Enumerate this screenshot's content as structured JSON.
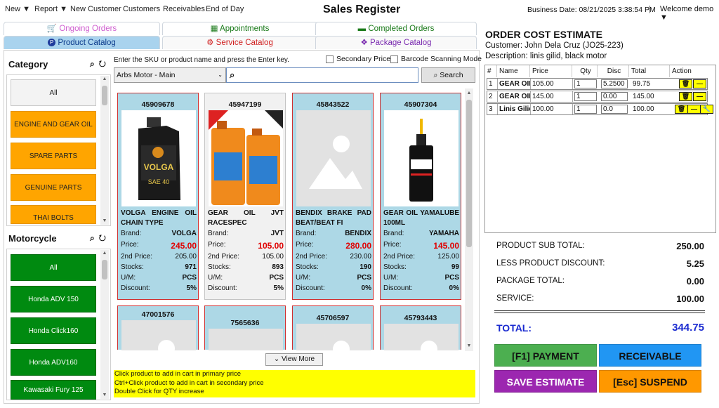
{
  "topbar": {
    "menu": [
      {
        "label": "New",
        "caret": "▼"
      },
      {
        "label": "Report",
        "caret": "▼"
      },
      {
        "label": "New Customer"
      },
      {
        "label": "Customers"
      },
      {
        "label": "Receivables"
      },
      {
        "label": "End of Day"
      }
    ],
    "title": "Sales Register",
    "business_date": "Business Date: 08/21/2025 3:38:54 PM",
    "separator": "|",
    "welcome": "Welcome demo ▼"
  },
  "tabs": {
    "row1": [
      "Ongoing Orders",
      "Appointments",
      "Completed Orders"
    ],
    "row2": [
      "Product Catalog",
      "Service Catalog",
      "Package Catalog"
    ],
    "icons": {
      "ongoing": "cart-icon",
      "appointments": "calendar-icon",
      "completed": "box-icon",
      "product": "product-icon",
      "service": "gears-icon",
      "package": "gift-icon"
    }
  },
  "sidebar": {
    "category_title": "Category",
    "categories": [
      "All",
      "ENGINE AND GEAR OIL",
      "SPARE PARTS",
      "GENUINE PARTS",
      "THAI BOLTS"
    ],
    "motorcycle_title": "Motorcycle",
    "motorcycles": [
      "All",
      "Honda ADV 150",
      "Honda Click160",
      "Honda ADV160",
      "Kawasaki Fury 125"
    ],
    "colors": {
      "orange": "#ffa500",
      "green": "#008a10"
    }
  },
  "catalog": {
    "hint": "Enter the SKU or product name and press the Enter key.",
    "secondary_price_label": "Secondary Price",
    "barcode_label": "Barcode Scanning Mode",
    "branch_select": "Arbs Motor - Main",
    "search_value": "",
    "search_button": "Search",
    "row_labels": {
      "brand": "Brand:",
      "price": "Price:",
      "price2": "2nd Price:",
      "stocks": "Stocks:",
      "um": "U/M:",
      "discount": "Discount:"
    },
    "products": [
      {
        "sku": "45909678",
        "name": "VOLGA ENGINE OIL CHAIN TYPE",
        "brand": "VOLGA",
        "price": "245.00",
        "price2": "205.00",
        "stocks": "971",
        "um": "PCS",
        "discount": "5%"
      },
      {
        "sku": "45947199",
        "name": "GEAR OIL JVT RACESPEC",
        "brand": "JVT",
        "price": "105.00",
        "price2": "105.00",
        "stocks": "893",
        "um": "PCS",
        "discount": "5%"
      },
      {
        "sku": "45843522",
        "name": "BENDIX BRAKE PAD BEAT/BEAT FI",
        "brand": "BENDIX",
        "price": "280.00",
        "price2": "230.00",
        "stocks": "190",
        "um": "PCS",
        "discount": "0%"
      },
      {
        "sku": "45907304",
        "name": "GEAR OIL YAMALUBE 100ML",
        "brand": "YAMAHA",
        "price": "145.00",
        "price2": "125.00",
        "stocks": "99",
        "um": "PCS",
        "discount": "0%"
      }
    ],
    "products_row2": [
      "47001576",
      "7565636",
      "45706597",
      "45793443"
    ],
    "view_more": "View More",
    "instructions": [
      "Click product to add in cart in primary price",
      "Ctrl+Click product to add in cart in secondary price",
      "Double Click for QTY increase"
    ]
  },
  "order": {
    "title": "ORDER COST ESTIMATE",
    "customer": "Customer: John Dela Cruz (JO25-223)",
    "description": "Description: linis gilid, black motor",
    "columns": [
      "#",
      "Name",
      "Price",
      "Qty",
      "Disc",
      "Total",
      "Action"
    ],
    "items": [
      {
        "no": "1",
        "name": "GEAR OIL",
        "price": "105.00",
        "qty": "1",
        "disc": "5.2500",
        "total": "99.75"
      },
      {
        "no": "2",
        "name": "GEAR OIL",
        "price": "145.00",
        "qty": "1",
        "disc": "0.00",
        "total": "145.00"
      },
      {
        "no": "3",
        "name": "Linis Gilid",
        "price": "100.00",
        "qty": "1",
        "disc": "0.0",
        "total": "100.00"
      }
    ],
    "summary": {
      "sub_total_label": "PRODUCT SUB TOTAL:",
      "sub_total": "250.00",
      "discount_label": "LESS PRODUCT DISCOUNT:",
      "discount": "5.25",
      "package_label": "PACKAGE TOTAL:",
      "package": "0.00",
      "service_label": "SERVICE:",
      "service": "100.00",
      "total_label": "TOTAL:",
      "total": "344.75"
    },
    "buttons": {
      "payment": "[F1] PAYMENT",
      "receivable": "RECEIVABLE",
      "save": "SAVE ESTIMATE",
      "suspend": "[Esc] SUSPEND"
    },
    "button_colors": {
      "payment": "#4caf50",
      "receivable": "#2196f3",
      "save": "#9c27b0",
      "suspend": "#ff9800"
    }
  }
}
